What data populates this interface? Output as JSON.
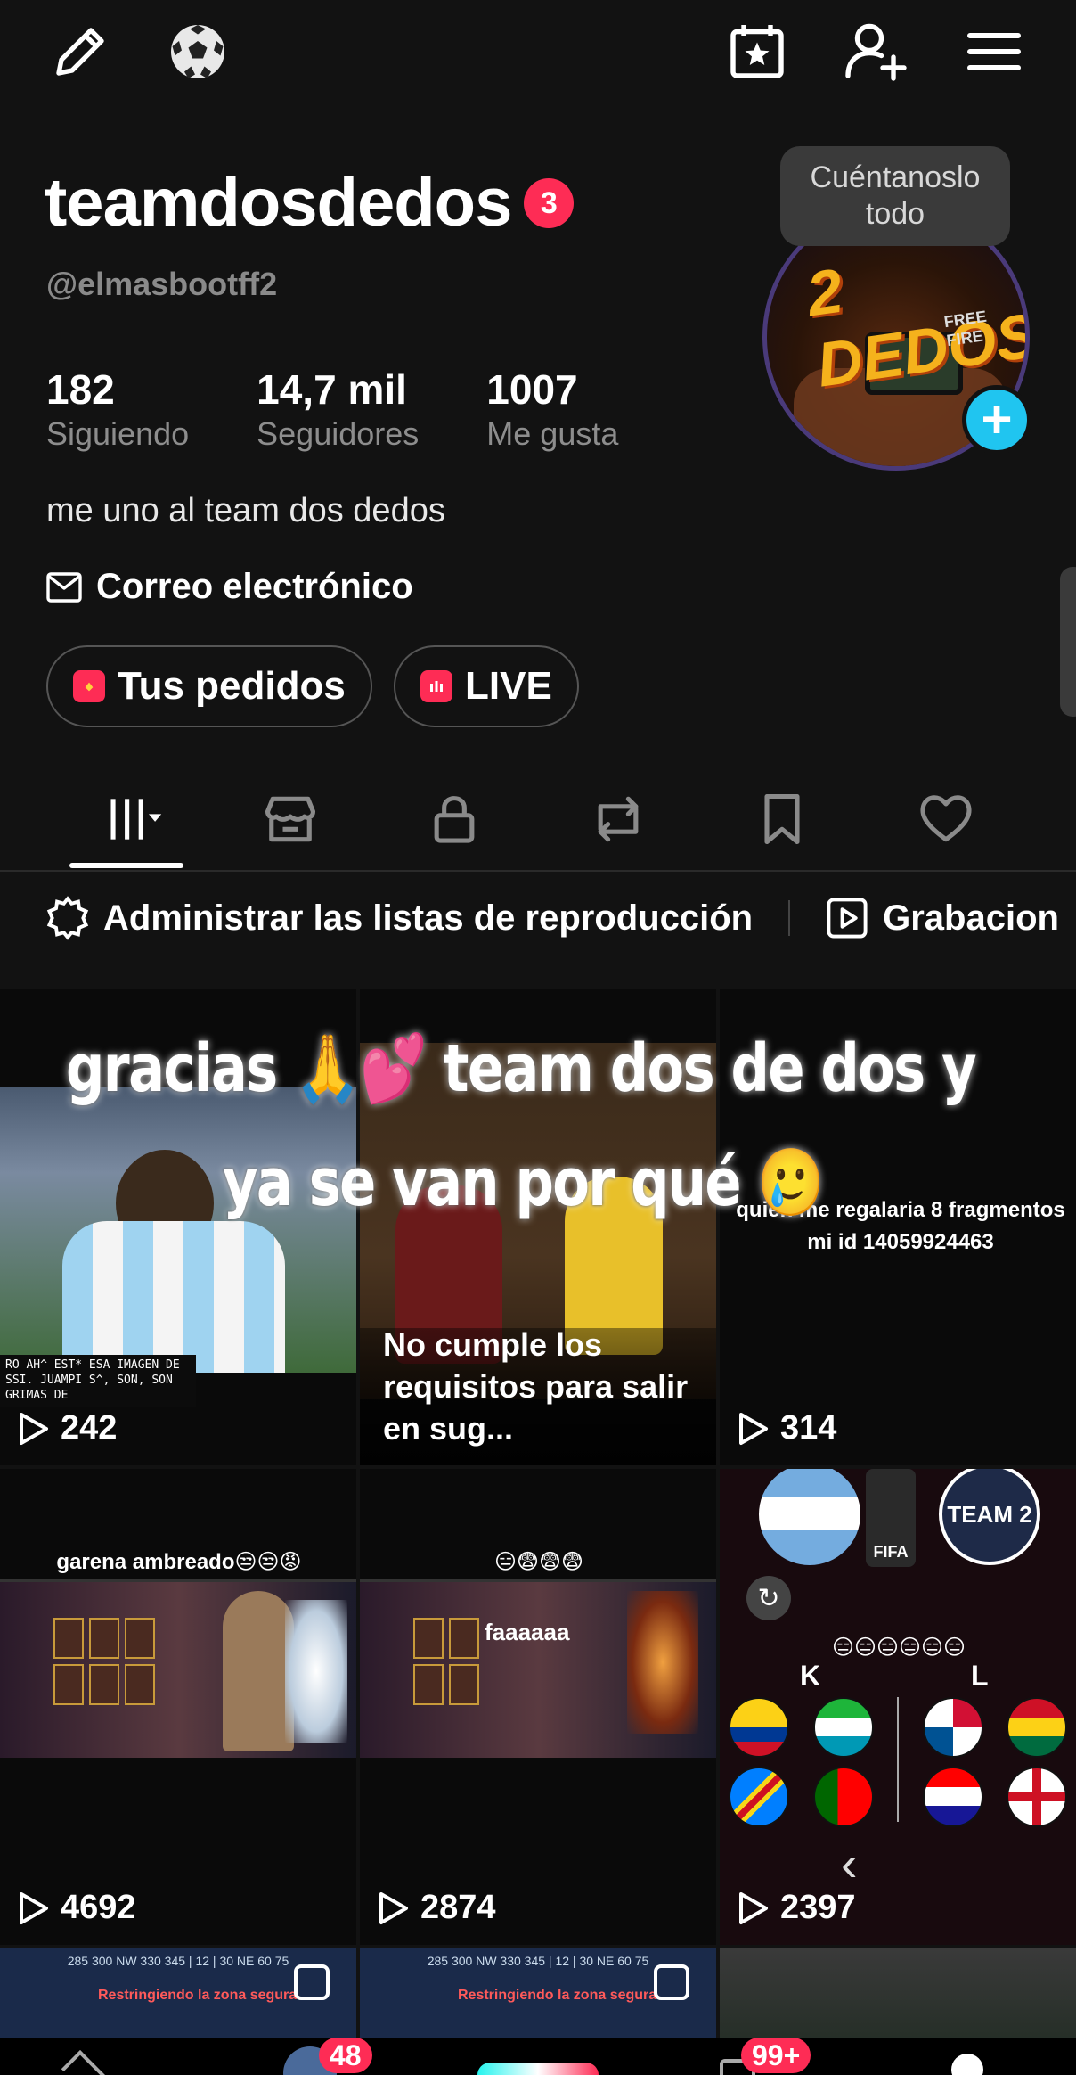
{
  "profile": {
    "username": "teamdosdedos",
    "notifications": "3",
    "handle": "@elmasbootff2",
    "stats": [
      {
        "value": "182",
        "label": "Siguiendo"
      },
      {
        "value": "14,7 mil",
        "label": "Seguidores"
      },
      {
        "value": "1007",
        "label": "Me gusta"
      }
    ],
    "tooltip": "Cuéntanoslo todo",
    "avatar_text": "2 DEDOS",
    "avatar_sub": "FREE FIRE",
    "bio": "me uno al team dos dedos",
    "email_label": "Correo electrónico",
    "buttons": {
      "orders": "Tus pedidos",
      "live": "LIVE"
    }
  },
  "top_icons": [
    "edit-icon",
    "soccer-ball-icon",
    "calendar-star-icon",
    "add-friend-icon",
    "menu-icon"
  ],
  "tabs": [
    "videos-tab",
    "shop-tab",
    "private-tab",
    "reposts-tab",
    "favorites-tab",
    "liked-tab"
  ],
  "playlist_bar": {
    "manage": "Administrar las listas de reproducción",
    "recordings": "Grabacion"
  },
  "overlay_text": {
    "line1": "gracias 🙏💕 team dos de dos y",
    "line2": "ya se van por qué 🥲"
  },
  "videos": [
    {
      "views": "242",
      "caption": "RO AH^ EST* ESA IMAGEN DE SSI. JUAMPI S^, SON, SON GRIMAS DE"
    },
    {
      "views": "",
      "caption": "No cumple los requisitos para salir en sug..."
    },
    {
      "views": "314",
      "caption": "quien me regalaria 8 fragmentos mi id  14059924463"
    },
    {
      "views": "4692",
      "caption": "garena ambreado😒😒😡"
    },
    {
      "views": "2874",
      "caption": "😑😨😨😨",
      "sub": "faaaaaa"
    },
    {
      "views": "2397",
      "caption": "😑😑😑😑😑😑",
      "teams": {
        "left": "K",
        "right": "L",
        "team2": "TEAM 2",
        "fifa": "FIFA"
      }
    },
    {
      "views": "",
      "caption": "Restringiendo la zona segura"
    },
    {
      "views": "",
      "caption": "Restringiendo la zona segura"
    },
    {
      "views": "",
      "caption": ""
    }
  ],
  "bottom_nav": {
    "inbox_badge": "48",
    "messages_badge": "99+"
  },
  "colors": {
    "accent": "#fe2c55",
    "add": "#20c5f0",
    "bg": "#121212"
  }
}
